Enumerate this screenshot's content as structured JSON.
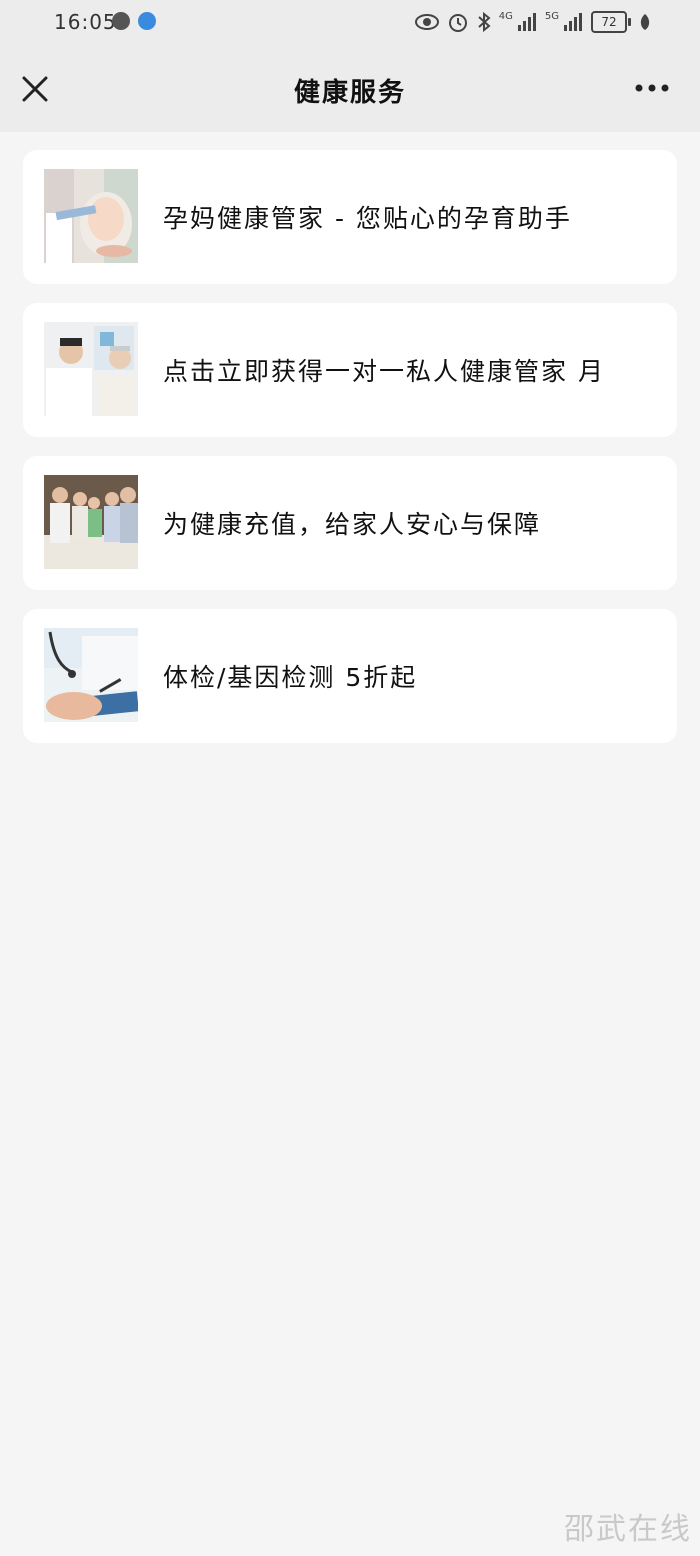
{
  "status_bar": {
    "time": "16:05",
    "network_1": "4G",
    "network_2": "5G",
    "battery": "72"
  },
  "nav": {
    "title": "健康服务",
    "close_icon": "close-icon",
    "more_icon": "more-icon"
  },
  "services": [
    {
      "label": "孕妈健康管家 - 您贴心的孕育助手",
      "image": "pregnancy-photo"
    },
    {
      "label": "点击立即获得一对一私人健康管家 月",
      "image": "doctor-consult-photo"
    },
    {
      "label": "为健康充值，给家人安心与保障",
      "image": "family-photo"
    },
    {
      "label": "体检/基因检测 5折起",
      "image": "medical-checkup-photo"
    }
  ],
  "watermark": "邵武在线"
}
